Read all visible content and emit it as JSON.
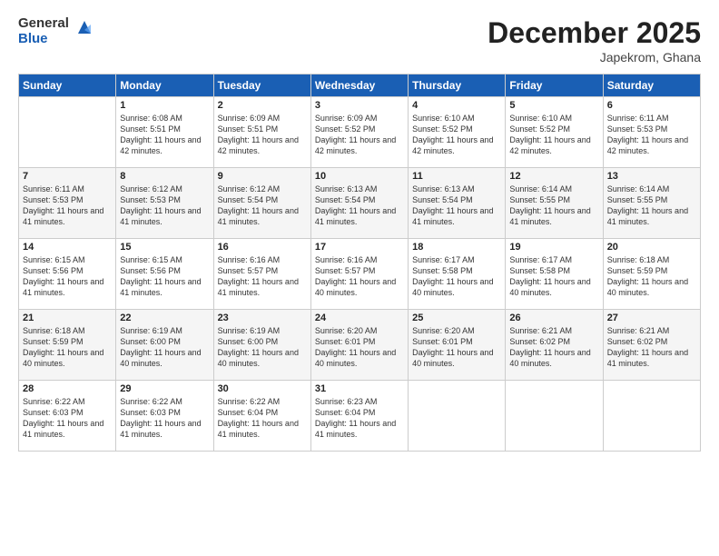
{
  "header": {
    "logo_general": "General",
    "logo_blue": "Blue",
    "month_year": "December 2025",
    "location": "Japekrom, Ghana"
  },
  "days_of_week": [
    "Sunday",
    "Monday",
    "Tuesday",
    "Wednesday",
    "Thursday",
    "Friday",
    "Saturday"
  ],
  "weeks": [
    [
      {
        "day": "",
        "sunrise": "",
        "sunset": "",
        "daylight": ""
      },
      {
        "day": "1",
        "sunrise": "6:08 AM",
        "sunset": "5:51 PM",
        "daylight": "11 hours and 42 minutes."
      },
      {
        "day": "2",
        "sunrise": "6:09 AM",
        "sunset": "5:51 PM",
        "daylight": "11 hours and 42 minutes."
      },
      {
        "day": "3",
        "sunrise": "6:09 AM",
        "sunset": "5:52 PM",
        "daylight": "11 hours and 42 minutes."
      },
      {
        "day": "4",
        "sunrise": "6:10 AM",
        "sunset": "5:52 PM",
        "daylight": "11 hours and 42 minutes."
      },
      {
        "day": "5",
        "sunrise": "6:10 AM",
        "sunset": "5:52 PM",
        "daylight": "11 hours and 42 minutes."
      },
      {
        "day": "6",
        "sunrise": "6:11 AM",
        "sunset": "5:53 PM",
        "daylight": "11 hours and 42 minutes."
      }
    ],
    [
      {
        "day": "7",
        "sunrise": "6:11 AM",
        "sunset": "5:53 PM",
        "daylight": "11 hours and 41 minutes."
      },
      {
        "day": "8",
        "sunrise": "6:12 AM",
        "sunset": "5:53 PM",
        "daylight": "11 hours and 41 minutes."
      },
      {
        "day": "9",
        "sunrise": "6:12 AM",
        "sunset": "5:54 PM",
        "daylight": "11 hours and 41 minutes."
      },
      {
        "day": "10",
        "sunrise": "6:13 AM",
        "sunset": "5:54 PM",
        "daylight": "11 hours and 41 minutes."
      },
      {
        "day": "11",
        "sunrise": "6:13 AM",
        "sunset": "5:54 PM",
        "daylight": "11 hours and 41 minutes."
      },
      {
        "day": "12",
        "sunrise": "6:14 AM",
        "sunset": "5:55 PM",
        "daylight": "11 hours and 41 minutes."
      },
      {
        "day": "13",
        "sunrise": "6:14 AM",
        "sunset": "5:55 PM",
        "daylight": "11 hours and 41 minutes."
      }
    ],
    [
      {
        "day": "14",
        "sunrise": "6:15 AM",
        "sunset": "5:56 PM",
        "daylight": "11 hours and 41 minutes."
      },
      {
        "day": "15",
        "sunrise": "6:15 AM",
        "sunset": "5:56 PM",
        "daylight": "11 hours and 41 minutes."
      },
      {
        "day": "16",
        "sunrise": "6:16 AM",
        "sunset": "5:57 PM",
        "daylight": "11 hours and 41 minutes."
      },
      {
        "day": "17",
        "sunrise": "6:16 AM",
        "sunset": "5:57 PM",
        "daylight": "11 hours and 40 minutes."
      },
      {
        "day": "18",
        "sunrise": "6:17 AM",
        "sunset": "5:58 PM",
        "daylight": "11 hours and 40 minutes."
      },
      {
        "day": "19",
        "sunrise": "6:17 AM",
        "sunset": "5:58 PM",
        "daylight": "11 hours and 40 minutes."
      },
      {
        "day": "20",
        "sunrise": "6:18 AM",
        "sunset": "5:59 PM",
        "daylight": "11 hours and 40 minutes."
      }
    ],
    [
      {
        "day": "21",
        "sunrise": "6:18 AM",
        "sunset": "5:59 PM",
        "daylight": "11 hours and 40 minutes."
      },
      {
        "day": "22",
        "sunrise": "6:19 AM",
        "sunset": "6:00 PM",
        "daylight": "11 hours and 40 minutes."
      },
      {
        "day": "23",
        "sunrise": "6:19 AM",
        "sunset": "6:00 PM",
        "daylight": "11 hours and 40 minutes."
      },
      {
        "day": "24",
        "sunrise": "6:20 AM",
        "sunset": "6:01 PM",
        "daylight": "11 hours and 40 minutes."
      },
      {
        "day": "25",
        "sunrise": "6:20 AM",
        "sunset": "6:01 PM",
        "daylight": "11 hours and 40 minutes."
      },
      {
        "day": "26",
        "sunrise": "6:21 AM",
        "sunset": "6:02 PM",
        "daylight": "11 hours and 40 minutes."
      },
      {
        "day": "27",
        "sunrise": "6:21 AM",
        "sunset": "6:02 PM",
        "daylight": "11 hours and 41 minutes."
      }
    ],
    [
      {
        "day": "28",
        "sunrise": "6:22 AM",
        "sunset": "6:03 PM",
        "daylight": "11 hours and 41 minutes."
      },
      {
        "day": "29",
        "sunrise": "6:22 AM",
        "sunset": "6:03 PM",
        "daylight": "11 hours and 41 minutes."
      },
      {
        "day": "30",
        "sunrise": "6:22 AM",
        "sunset": "6:04 PM",
        "daylight": "11 hours and 41 minutes."
      },
      {
        "day": "31",
        "sunrise": "6:23 AM",
        "sunset": "6:04 PM",
        "daylight": "11 hours and 41 minutes."
      },
      {
        "day": "",
        "sunrise": "",
        "sunset": "",
        "daylight": ""
      },
      {
        "day": "",
        "sunrise": "",
        "sunset": "",
        "daylight": ""
      },
      {
        "day": "",
        "sunrise": "",
        "sunset": "",
        "daylight": ""
      }
    ]
  ]
}
